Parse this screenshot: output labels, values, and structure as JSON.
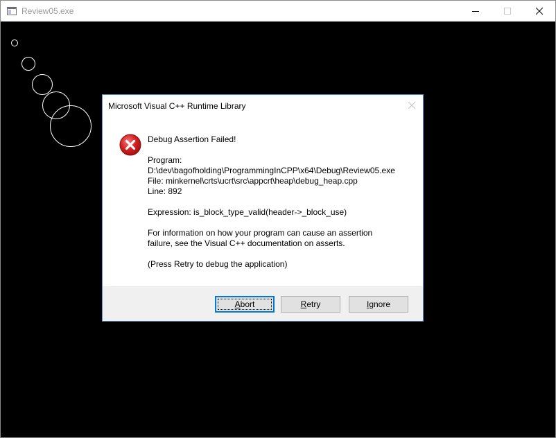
{
  "window": {
    "title": "Review05.exe",
    "controls": {
      "minimize_icon": "minimize-icon",
      "maximize_icon": "maximize-icon",
      "close_icon": "close-icon"
    }
  },
  "canvas": {
    "background": "#000000",
    "circle_color": "#ffffff",
    "circle_count": 5
  },
  "dialog": {
    "title": "Microsoft Visual C++ Runtime Library",
    "icon": "error-icon",
    "heading": "Debug Assertion Failed!",
    "program_label": "Program:",
    "program_path": "D:\\dev\\bagofholding\\ProgrammingInCPP\\x64\\Debug\\Review05.exe",
    "file_line": "File: minkernel\\crts\\ucrt\\src\\appcrt\\heap\\debug_heap.cpp",
    "line_line": "Line: 892",
    "expression_line": "Expression: is_block_type_valid(header->_block_use)",
    "info_line1": "For information on how your program can cause an assertion",
    "info_line2": "failure, see the Visual C++ documentation on asserts.",
    "retry_hint": "(Press Retry to debug the application)",
    "buttons": {
      "abort": "Abort",
      "retry": "Retry",
      "ignore": "Ignore"
    }
  }
}
